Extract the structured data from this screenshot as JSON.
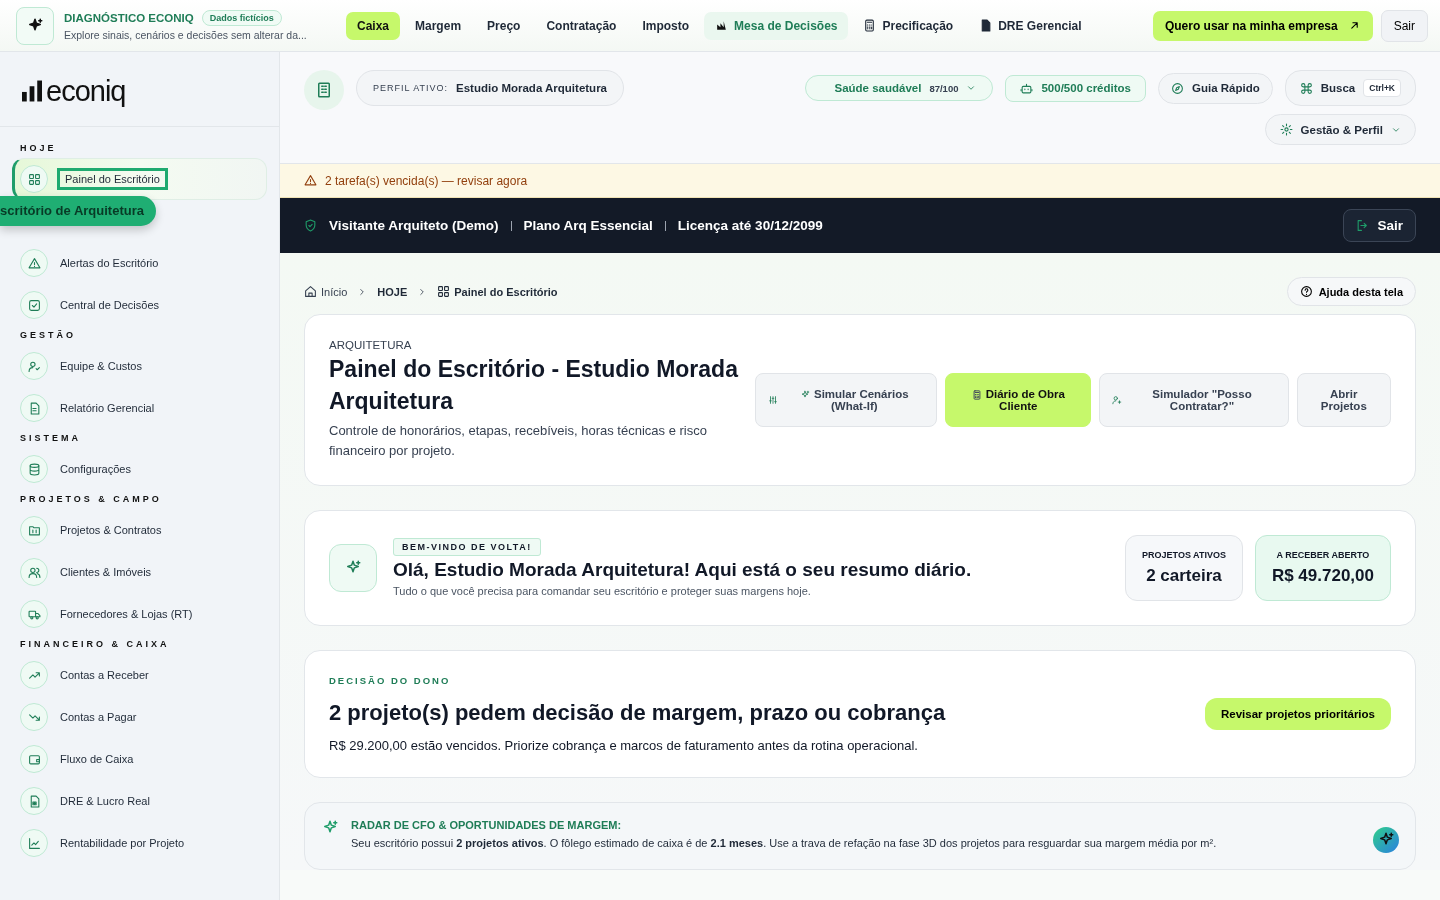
{
  "topbar": {
    "title": "DIAGNÓSTICO ECONIQ",
    "badge": "Dados fictícios",
    "subtitle": "Explore sinais, cenários e decisões sem alterar da...",
    "tabs": [
      {
        "label": "Caixa",
        "selected": true,
        "kind": "plain"
      },
      {
        "label": "Margem",
        "selected": false,
        "kind": "plain"
      },
      {
        "label": "Preço",
        "selected": false,
        "kind": "plain"
      },
      {
        "label": "Contratação",
        "selected": false,
        "kind": "plain"
      },
      {
        "label": "Imposto",
        "selected": false,
        "kind": "plain"
      },
      {
        "label": "Mesa de Decisões",
        "selected": false,
        "kind": "accent"
      },
      {
        "label": "Precificação",
        "selected": false,
        "kind": "plain"
      },
      {
        "label": "DRE Gerencial",
        "selected": false,
        "kind": "plain"
      }
    ],
    "cta": "Quero usar na minha empresa",
    "exit": "Sair"
  },
  "sidebar": {
    "logo": "econiq",
    "tooltip": "scritório de Arquitetura",
    "sections": [
      {
        "title": "HOJE",
        "items": [
          {
            "label": "Painel do Escritório",
            "selected": true
          },
          {
            "label": "Alertas do Escritório",
            "selected": false
          },
          {
            "label": "Central de Decisões",
            "selected": false
          }
        ]
      },
      {
        "title": "GESTÃO",
        "items": [
          {
            "label": "Equipe & Custos",
            "selected": false
          },
          {
            "label": "Relatório Gerencial",
            "selected": false
          }
        ]
      },
      {
        "title": "SISTEMA",
        "items": [
          {
            "label": "Configurações",
            "selected": false
          }
        ]
      },
      {
        "title": "PROJETOS & CAMPO",
        "items": [
          {
            "label": "Projetos & Contratos",
            "selected": false
          },
          {
            "label": "Clientes & Imóveis",
            "selected": false
          },
          {
            "label": "Fornecedores & Lojas (RT)",
            "selected": false
          }
        ]
      },
      {
        "title": "FINANCEIRO & CAIXA",
        "items": [
          {
            "label": "Contas a Receber",
            "selected": false
          },
          {
            "label": "Contas a Pagar",
            "selected": false
          },
          {
            "label": "Fluxo de Caixa",
            "selected": false
          },
          {
            "label": "DRE & Lucro Real",
            "selected": false
          },
          {
            "label": "Rentabilidade por Projeto",
            "selected": false
          }
        ]
      }
    ]
  },
  "header": {
    "profile_label": "PERFIL ATIVO:",
    "profile_name": "Estudio Morada Arquitetura",
    "health": "Saúde saudável",
    "health_score": "87/100",
    "credits": "500/500 créditos",
    "guide": "Guia Rápido",
    "search": "Busca",
    "search_key": "Ctrl+K",
    "settings": "Gestão & Perfil"
  },
  "alert": "2 tarefa(s) vencida(s) — revisar agora",
  "account_bar": {
    "user": "Visitante Arquiteto (Demo)",
    "plan": "Plano Arq Essencial",
    "license": "Licença até 30/12/2099",
    "exit": "Sair"
  },
  "breadcrumb": [
    "Início",
    "HOJE",
    "Painel do Escritório"
  ],
  "help": "Ajuda desta tela",
  "page_header": {
    "eyebrow": "ARQUITETURA",
    "title": "Painel do Escritório - Estudio Morada Arquitetura",
    "description": "Controle de honorários, etapas, recebíveis, horas técnicas e risco financeiro por projeto.",
    "actions": [
      {
        "label": "Simular Cenários (What-If)",
        "selected": false
      },
      {
        "label": "Diário de Obra Cliente",
        "selected": true
      },
      {
        "label": "Simulador \"Posso Contratar?\"",
        "selected": false
      },
      {
        "label": "Abrir Projetos",
        "selected": false
      }
    ]
  },
  "welcome": {
    "badge": "BEM-VINDO DE VOLTA!",
    "title": "Olá, Estudio Morada Arquitetura! Aqui está o seu resumo diário.",
    "subtitle": "Tudo o que você precisa para comandar seu escritório e proteger suas margens hoje.",
    "stats": [
      {
        "label": "PROJETOS ATIVOS",
        "value": "2 carteira",
        "selected": false
      },
      {
        "label": "A RECEBER ABERTO",
        "value": "R$ 49.720,00",
        "selected": true
      }
    ]
  },
  "decision": {
    "eyebrow": "DECISÃO DO DONO",
    "title": "2 projeto(s) pedem decisão de margem, prazo ou cobrança",
    "text": "R$ 29.200,00 estão vencidos. Priorize cobrança e marcos de faturamento antes da rotina operacional.",
    "button": "Revisar projetos prioritários"
  },
  "radar": {
    "title": "RADAR DE CFO & OPORTUNIDADES DE MARGEM:",
    "text": "Seu escritório possui **2 projetos ativos**. O fôlego estimado de caixa é de **2.1 meses**. Use a trava de refação na fase 3D dos projetos para resguardar sua margem média por m²."
  }
}
